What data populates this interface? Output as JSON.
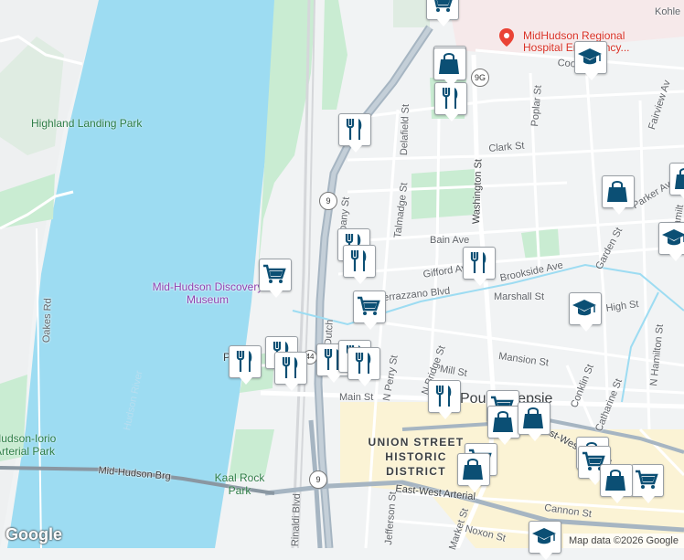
{
  "labels": {
    "highland_landing_park": "Highland Landing Park",
    "mid_hudson_discovery_museum": "Mid-Hudson Discovery Museum",
    "hospital": "MidHudson Regional Hospital Emergency...",
    "hudson_river": "Hudson River",
    "kaal_rock_park": "Kaal Rock Park",
    "iorio_park": "Hudson-Iorio Arterial Park",
    "union_street_district": "UNION STREET HISTORIC DISTRICT",
    "poughkeepsie": "Poughkeepsie",
    "mid_hudson_bridge": "Mid-Hudson Brg",
    "oakes_rd": "Oakes Rd",
    "cook_st": "Cook St",
    "poplar_st": "Poplar St",
    "delafield_st": "Delafield St",
    "clark_st": "Clark St",
    "washington_st": "Washington St",
    "talmadge_st": "Talmadge St",
    "bain_ave": "Bain Ave",
    "gifford_ave": "Gifford Ave",
    "brookside_ave": "Brookside Ave",
    "marshall_st": "Marshall St",
    "verrazzano_blvd": "Verrazzano Blvd",
    "mansion_st": "Mansion St",
    "mill_st": "Mill St",
    "main_st": "Main St",
    "n_perry_st": "N Perry St",
    "n_bridge_st": "N Bridge St",
    "east_west_arterial": "East-West Arterial",
    "east_west_arterial_2": "East-West Arterial",
    "cannon_st": "Cannon St",
    "noxon_st": "Noxon St",
    "jefferson_st": "Jefferson St",
    "market_st": "Market St",
    "rinaldi_blvd": "Rinaldi Blvd",
    "catharine_st": "Catharine St",
    "conklin_st": "Conklin St",
    "n_hamilton_st": "N Hamilton St",
    "high_st": "High St",
    "garden_st": "Garden St",
    "parker_ave": "Parker Ave",
    "fairview_ave": "Fairview Av",
    "kohler": "Kohle",
    "hamilton_right": "Hamilt",
    "albany_st": "Albany St",
    "dutchess_ave": "Dutch",
    "pok_fragment": "P",
    "route_9": "9",
    "route_9_south": "9",
    "route_9g": "9G",
    "route_44": "44"
  },
  "markers": [
    {
      "name": "grocery-marker-1",
      "icon": "cart"
    },
    {
      "name": "shop-marker-1",
      "icon": "bag"
    },
    {
      "name": "restaurant-marker-1",
      "icon": "fork-knife"
    },
    {
      "name": "school-marker-1",
      "icon": "graduation-cap"
    },
    {
      "name": "restaurant-marker-2",
      "icon": "fork-knife"
    },
    {
      "name": "shop-marker-2",
      "icon": "bag"
    },
    {
      "name": "shop-marker-3",
      "icon": "bag"
    },
    {
      "name": "shop-marker-4",
      "icon": "bag"
    },
    {
      "name": "restaurant-marker-3",
      "icon": "fork-knife"
    },
    {
      "name": "restaurant-marker-4",
      "icon": "fork-knife"
    },
    {
      "name": "school-marker-2",
      "icon": "graduation-cap"
    },
    {
      "name": "restaurant-marker-5",
      "icon": "fork-knife"
    },
    {
      "name": "grocery-marker-2",
      "icon": "cart"
    },
    {
      "name": "grocery-marker-3",
      "icon": "cart"
    },
    {
      "name": "school-marker-3",
      "icon": "graduation-cap"
    },
    {
      "name": "restaurant-marker-6",
      "icon": "fork-knife"
    },
    {
      "name": "restaurant-marker-7",
      "icon": "fork-knife"
    },
    {
      "name": "restaurant-marker-8",
      "icon": "fork-knife"
    },
    {
      "name": "restaurant-marker-9",
      "icon": "fork-knife"
    },
    {
      "name": "restaurant-marker-10",
      "icon": "fork-knife"
    },
    {
      "name": "restaurant-marker-11",
      "icon": "fork-knife"
    },
    {
      "name": "restaurant-marker-12",
      "icon": "fork-knife"
    },
    {
      "name": "grocery-marker-4",
      "icon": "cart"
    },
    {
      "name": "shop-marker-5",
      "icon": "bag"
    },
    {
      "name": "shop-marker-6",
      "icon": "bag"
    },
    {
      "name": "shop-marker-7",
      "icon": "bag"
    },
    {
      "name": "grocery-marker-5",
      "icon": "cart"
    },
    {
      "name": "shop-marker-8",
      "icon": "bag"
    },
    {
      "name": "grocery-marker-6",
      "icon": "cart"
    },
    {
      "name": "school-marker-4",
      "icon": "graduation-cap"
    },
    {
      "name": "grocery-marker-7",
      "icon": "cart"
    },
    {
      "name": "shop-marker-9",
      "icon": "bag"
    }
  ],
  "footer": {
    "logo": "Google",
    "attribution": "Map data ©2026 Google"
  },
  "colors": {
    "water": "#9ddcf2",
    "park": "#c9ecd2",
    "road": "#ffffff",
    "highway": "#a6b5c2",
    "marker_icon": "#0b4f74",
    "district": "#fbf3d5"
  }
}
